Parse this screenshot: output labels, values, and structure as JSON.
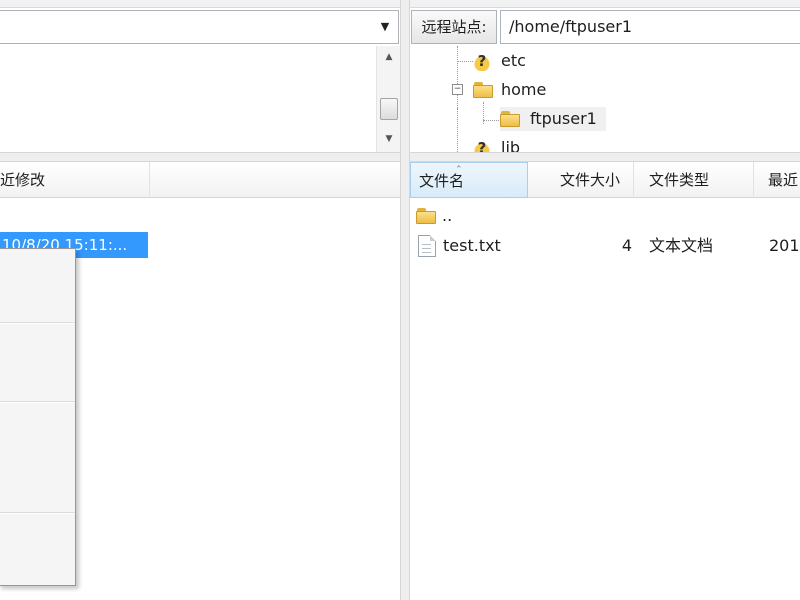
{
  "remote_site": {
    "label": "远程站点:",
    "path": "/home/ftpuser1"
  },
  "remote_tree": {
    "items": [
      {
        "name": "etc",
        "icon": "unknown-folder-icon"
      },
      {
        "name": "home",
        "icon": "folder-open-icon",
        "expanded": true
      },
      {
        "name": "ftpuser1",
        "icon": "folder-icon",
        "selected": true
      },
      {
        "name": "lib",
        "icon": "unknown-folder-icon"
      }
    ]
  },
  "local_list": {
    "columns": [
      "近修改"
    ],
    "selected_date": "10/8/20 15:11:..."
  },
  "remote_list": {
    "columns": [
      "文件名",
      "文件大小",
      "文件类型",
      "最近"
    ],
    "rows": [
      {
        "name": "..",
        "size": "",
        "type": "",
        "modified": "",
        "icon": "folder-icon"
      },
      {
        "name": "test.txt",
        "size": "4",
        "type": "文本文档",
        "modified": "201",
        "icon": "text-file-icon"
      }
    ]
  },
  "colors": {
    "selection": "#3399ff",
    "header_active": "#d8ebf9",
    "folder": "#eebd46"
  }
}
